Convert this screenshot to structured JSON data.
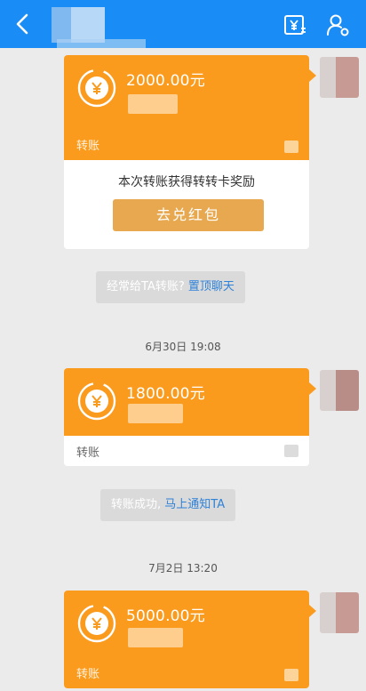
{
  "header": {
    "back_icon": "chevron-left-icon",
    "title": "",
    "right_icons": [
      "transfer-yuan-icon",
      "user-settings-icon"
    ],
    "bg_color": "#1a8cf5"
  },
  "messages": [
    {
      "amount": "2000.00元",
      "label": "转账",
      "reward_text": "本次转账获得转转卡奖励",
      "reward_button": "去兑红包"
    },
    {
      "notice_text": "经常给TA转账?",
      "notice_link": "置顶聊天"
    },
    {
      "timestamp": "6月30日 19:08"
    },
    {
      "amount": "1800.00元",
      "label": "转账"
    },
    {
      "notice_text": "转账成功,",
      "notice_link": "马上通知TA"
    },
    {
      "timestamp": "7月2日 13:20"
    },
    {
      "amount": "5000.00元",
      "label": "转账"
    }
  ],
  "colors": {
    "card_orange": "#fb9b1e",
    "link_blue": "#2f82d8",
    "reward_button": "#e7a84f"
  }
}
